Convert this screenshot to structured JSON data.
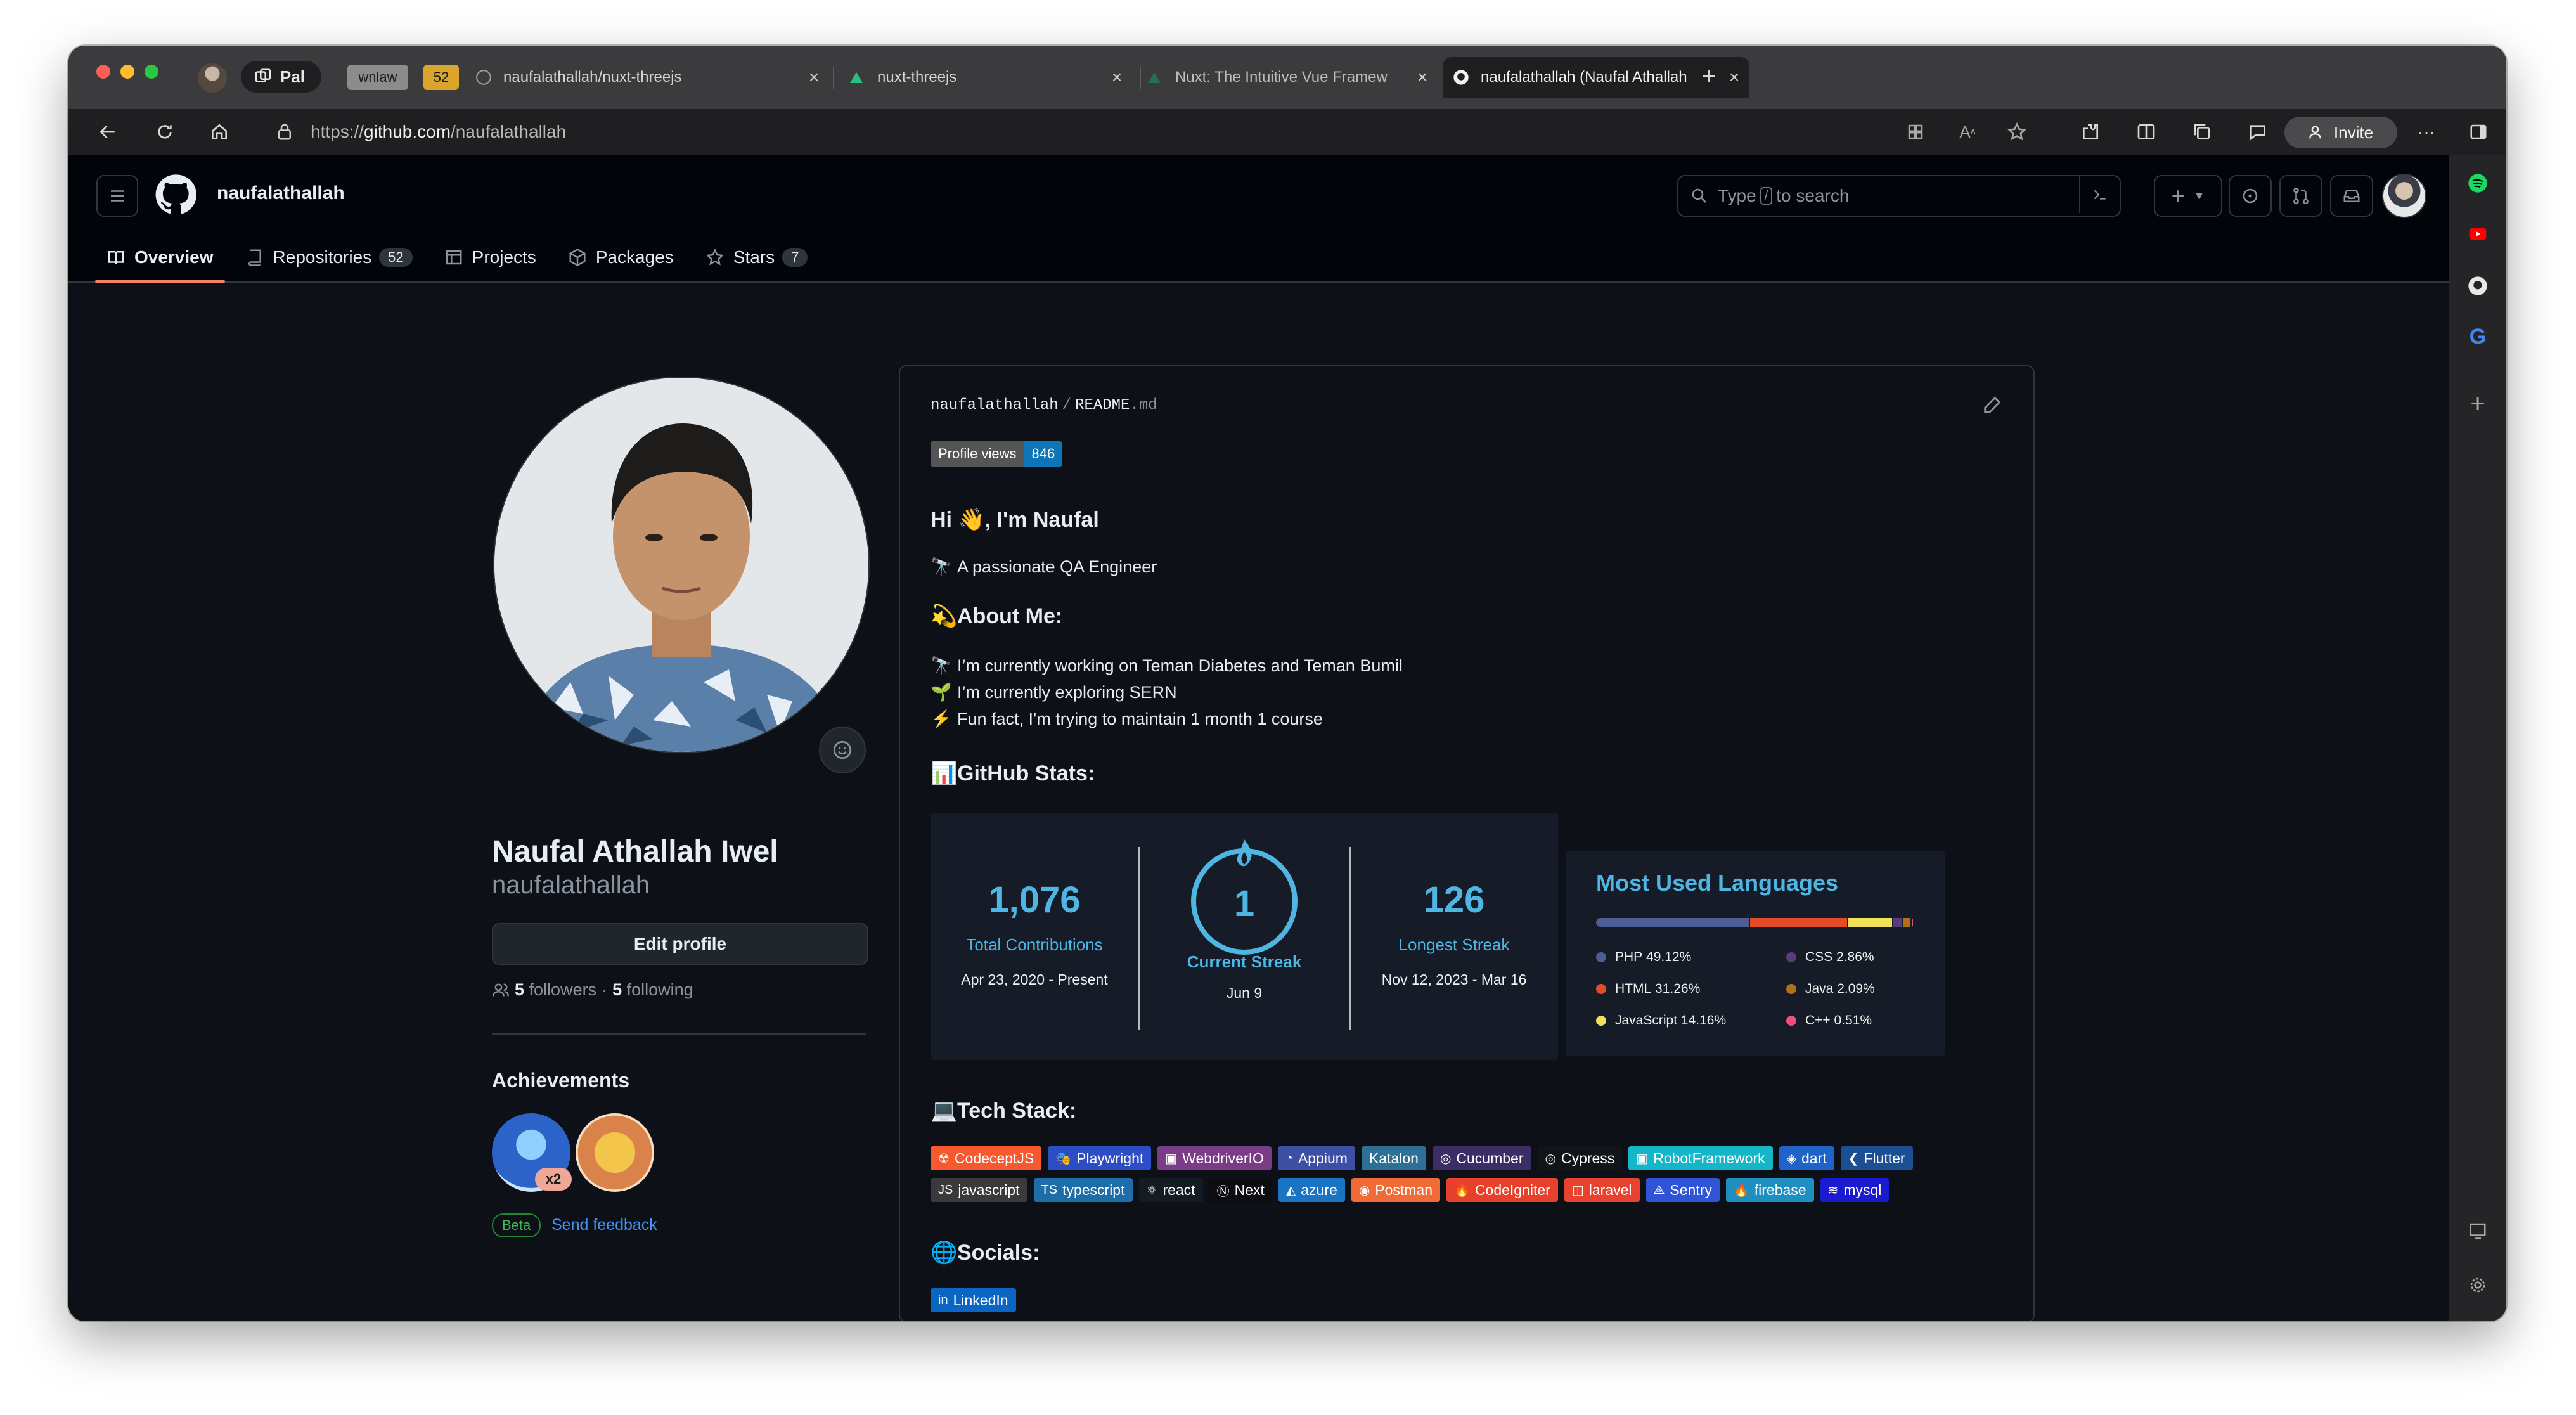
{
  "browser": {
    "profile_label": "Pal",
    "group_chips": [
      "wnlaw",
      "52"
    ],
    "tabs": [
      {
        "title": "naufalathallah/nuxt-threejs"
      },
      {
        "title": "nuxt-threejs"
      },
      {
        "title": "Nuxt: The Intuitive Vue Framew"
      },
      {
        "title": "naufalathallah (Naufal Athallah"
      }
    ],
    "url_prefix": "https://",
    "url_host": "github.com",
    "url_path": "/naufalathallah",
    "invite_label": "Invite"
  },
  "github": {
    "header_user": "naufalathallah",
    "search_pre": "Type",
    "search_key": "/",
    "search_post": "to search",
    "nav": [
      {
        "label": "Overview"
      },
      {
        "label": "Repositories",
        "count": "52"
      },
      {
        "label": "Projects"
      },
      {
        "label": "Packages"
      },
      {
        "label": "Stars",
        "count": "7"
      }
    ]
  },
  "profile": {
    "full_name": "Naufal Athallah Iwel",
    "login": "naufalathallah",
    "edit_label": "Edit profile",
    "followers_count": "5",
    "followers_label": "followers",
    "dot": "·",
    "following_count": "5",
    "following_label": "following",
    "achievements_title": "Achievements",
    "badge_multiplier": "x2",
    "beta_label": "Beta",
    "feedback_label": "Send feedback"
  },
  "readme": {
    "owner": "naufalathallah",
    "path_sep": "/",
    "file": "README",
    "ext": ".md",
    "pv_label": "Profile views",
    "pv_count": "846",
    "greeting": "Hi 👋, I'm Naufal",
    "tagline": "A passionate QA Engineer",
    "about_title": "About Me:",
    "about_items": [
      {
        "emoji": "🔭",
        "text": "I’m currently working on Teman Diabetes and Teman Bumil"
      },
      {
        "emoji": "🌱",
        "text": "I’m currently exploring SERN"
      },
      {
        "emoji": "⚡",
        "text": "Fun fact, I'm trying to maintain 1 month 1 course"
      }
    ],
    "stats_title": "GitHub Stats:",
    "streak": {
      "total": "1,076",
      "total_label": "Total Contributions",
      "total_range": "Apr 23, 2020 - Present",
      "current": "1",
      "current_label": "Current Streak",
      "current_date": "Jun 9",
      "longest": "126",
      "longest_label": "Longest Streak",
      "longest_range": "Nov 12, 2023 - Mar 16"
    },
    "langs": {
      "title": "Most Used Languages",
      "items": [
        {
          "name": "PHP",
          "pct": "49.12%",
          "value": 49.12,
          "color": "#4f5d95"
        },
        {
          "name": "HTML",
          "pct": "31.26%",
          "value": 31.26,
          "color": "#e34c26"
        },
        {
          "name": "JavaScript",
          "pct": "14.16%",
          "value": 14.16,
          "color": "#f1e05a"
        },
        {
          "name": "CSS",
          "pct": "2.86%",
          "value": 2.86,
          "color": "#563d7c"
        },
        {
          "name": "Java",
          "pct": "2.09%",
          "value": 2.09,
          "color": "#b07219"
        },
        {
          "name": "C++",
          "pct": "0.51%",
          "value": 0.51,
          "color": "#f34b7d"
        }
      ]
    },
    "tech_title": "Tech Stack:",
    "tech_row1": [
      {
        "label": "CodeceptJS",
        "color": "#f6592e",
        "icon": "☢"
      },
      {
        "label": "Playwright",
        "color": "#2d4dc4",
        "icon": "🎭"
      },
      {
        "label": "WebdriverIO",
        "color": "#7a3b87",
        "icon": "▣"
      },
      {
        "label": "Appium",
        "color": "#3d4fa4",
        "icon": "◔"
      },
      {
        "label": "Katalon",
        "color": "#2e6f95",
        "icon": ""
      },
      {
        "label": "Cucumber",
        "color": "#3b2e66",
        "icon": "◎"
      },
      {
        "label": "Cypress",
        "color": "#111418",
        "icon": "◎"
      },
      {
        "label": "RobotFramework",
        "color": "#16b6c9",
        "icon": "▣"
      },
      {
        "label": "dart",
        "color": "#1f63c9",
        "icon": "◈"
      },
      {
        "label": "Flutter",
        "color": "#1c4e93",
        "icon": "❮"
      }
    ],
    "tech_row2": [
      {
        "label": "javascript",
        "color": "#3a3a3a",
        "icon": "JS"
      },
      {
        "label": "typescript",
        "color": "#1d6ea8",
        "icon": "TS"
      },
      {
        "label": "react",
        "color": "#151b23",
        "icon": "⚛"
      },
      {
        "label": "Next",
        "color": "#0b0d10",
        "icon": "Ⓝ"
      },
      {
        "label": "azure",
        "color": "#1a74c4",
        "icon": "◭"
      },
      {
        "label": "Postman",
        "color": "#f06b36",
        "icon": "◉"
      },
      {
        "label": "CodeIgniter",
        "color": "#e8412b",
        "icon": "🔥"
      },
      {
        "label": "laravel",
        "color": "#e8432f",
        "icon": "◫"
      },
      {
        "label": "Sentry",
        "color": "#2f54d6",
        "icon": "⟁"
      },
      {
        "label": "firebase",
        "color": "#1f8fc1",
        "icon": "🔥"
      },
      {
        "label": "mysql",
        "color": "#1a1ad0",
        "icon": "≋"
      }
    ],
    "socials_title": "Socials:",
    "socials": [
      {
        "label": "LinkedIn",
        "color": "#0a66c2"
      }
    ]
  },
  "colors": {
    "accent": "#f78166",
    "link": "#4493f8",
    "streak": "#4fb6e3"
  }
}
